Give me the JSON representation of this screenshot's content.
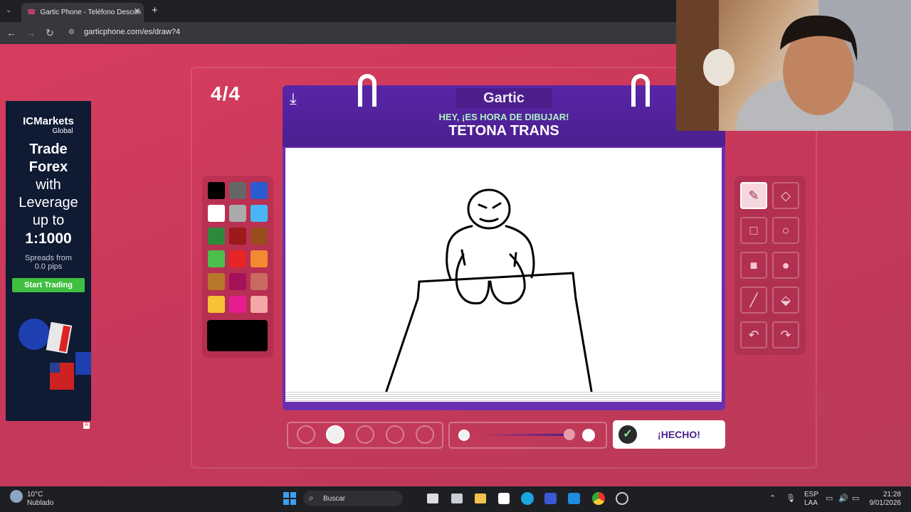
{
  "browser": {
    "tab_title": "Gartic Phone - Teléfono Descon",
    "url": "garticphone.com/es/draw?4"
  },
  "game": {
    "round": "4/4",
    "logo": "Gartic",
    "prompt": "HEY, ¡ES HORA DE DIBUJAR!",
    "word": "TETONA TRANS",
    "done_label": "¡HECHO!",
    "palette": [
      "#000000",
      "#666666",
      "#2a5ccf",
      "#ffffff",
      "#aaaaaa",
      "#48b6f5",
      "#2d8a3a",
      "#9c1a1a",
      "#9a4d1c",
      "#4bbf4a",
      "#e82525",
      "#f28a31",
      "#b8762a",
      "#a4125a",
      "#c96a62",
      "#f7c235",
      "#e61c8f",
      "#f5a6a6"
    ],
    "current_color": "#000000",
    "tools": [
      "pencil-icon",
      "eraser-icon",
      "rect-outline-icon",
      "circle-outline-icon",
      "rect-fill-icon",
      "circle-fill-icon",
      "line-icon",
      "fill-bucket-icon",
      "undo-icon",
      "redo-icon"
    ]
  },
  "ad": {
    "brand": "ICMarkets",
    "brand_sub": "Global",
    "l1": "Trade",
    "l2": "Forex",
    "l3": "with",
    "l4": "Leverage",
    "l5": "up to",
    "l6": "1:1000",
    "spreads1": "Spreads from",
    "spreads2": "0.0 pips",
    "cta": "Start Trading"
  },
  "taskbar": {
    "temp": "10°C",
    "weather": "Nublado",
    "search": "Buscar",
    "lang1": "ESP",
    "lang2": "LAA",
    "time": "21:28",
    "date": "9/01/2026"
  }
}
